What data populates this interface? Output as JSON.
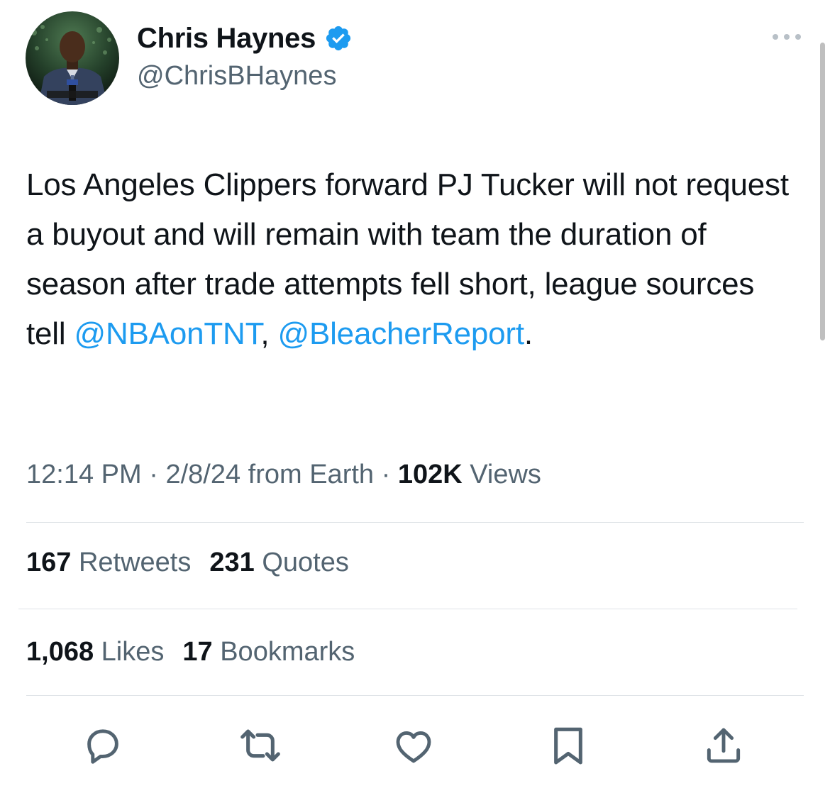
{
  "author": {
    "display_name": "Chris Haynes",
    "handle": "@ChrisBHaynes",
    "verified_icon": "verified-badge-icon",
    "avatar_icon": "avatar-photo"
  },
  "more_icon": "more-horizontal-icon",
  "tweet": {
    "text_main": "Los Angeles Clippers forward PJ Tucker will not request a buyout and will remain with team the duration of season after trade attempts fell short, league sources tell ",
    "mention_1": "@NBAonTNT",
    "separator": ", ",
    "mention_2": "@BleacherReport",
    "text_end": "."
  },
  "meta": {
    "time": "12:14 PM",
    "dot_1": " · ",
    "date": "2/8/24",
    "source": " from Earth",
    "dot_2": " · ",
    "views_count": "102K",
    "views_label": " Views"
  },
  "stats": {
    "retweets_count": "167",
    "retweets_label": " Retweets",
    "quotes_count": "231",
    "quotes_label": " Quotes",
    "likes_count": "1,068",
    "likes_label": " Likes",
    "bookmarks_count": "17",
    "bookmarks_label": " Bookmarks"
  },
  "actions": {
    "reply_icon": "reply-icon",
    "retweet_icon": "retweet-icon",
    "like_icon": "heart-icon",
    "bookmark_icon": "bookmark-icon",
    "share_icon": "share-icon"
  },
  "colors": {
    "text": "#0f1419",
    "secondary": "#536471",
    "link": "#1d9bf0",
    "divider": "#dfe3e7",
    "verified": "#1d9bf0"
  }
}
